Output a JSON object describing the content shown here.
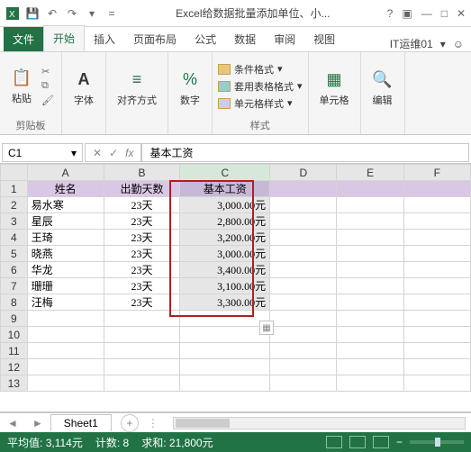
{
  "window": {
    "title": "Excel给数据批量添加单位、小...",
    "help_icon": "?",
    "user": "IT运维01"
  },
  "ribbon": {
    "tabs": [
      "文件",
      "开始",
      "插入",
      "页面布局",
      "公式",
      "数据",
      "审阅",
      "视图"
    ],
    "active_tab": "开始",
    "groups": {
      "clipboard": {
        "paste": "粘贴",
        "label": "剪贴板"
      },
      "font": {
        "label": "字体"
      },
      "align": {
        "label": "对齐方式"
      },
      "number": {
        "label": "数字"
      },
      "styles": {
        "cond": "条件格式",
        "table": "套用表格格式",
        "cell": "单元格样式",
        "label": "样式"
      },
      "cells": {
        "label": "单元格"
      },
      "editing": {
        "label": "编辑"
      }
    }
  },
  "formula_bar": {
    "name_box": "C1",
    "fx": "fx",
    "value": "基本工资"
  },
  "columns": [
    "A",
    "B",
    "C",
    "D",
    "E",
    "F"
  ],
  "header_row": {
    "name": "姓名",
    "days": "出勤天数",
    "salary": "基本工资"
  },
  "rows": [
    {
      "name": "易水寒",
      "days": "23天",
      "salary": "3,000.00元"
    },
    {
      "name": "星辰",
      "days": "23天",
      "salary": "2,800.00元"
    },
    {
      "name": "王琦",
      "days": "23天",
      "salary": "3,200.00元"
    },
    {
      "name": "晓燕",
      "days": "23天",
      "salary": "3,000.00元"
    },
    {
      "name": "华龙",
      "days": "23天",
      "salary": "3,400.00元"
    },
    {
      "name": "珊珊",
      "days": "23天",
      "salary": "3,100.00元"
    },
    {
      "name": "汪梅",
      "days": "23天",
      "salary": "3,300.00元"
    }
  ],
  "sheets": {
    "active": "Sheet1"
  },
  "status": {
    "avg_label": "平均值:",
    "avg": "3,114元",
    "count_label": "计数:",
    "count": "8",
    "sum_label": "求和:",
    "sum": "21,800元"
  }
}
